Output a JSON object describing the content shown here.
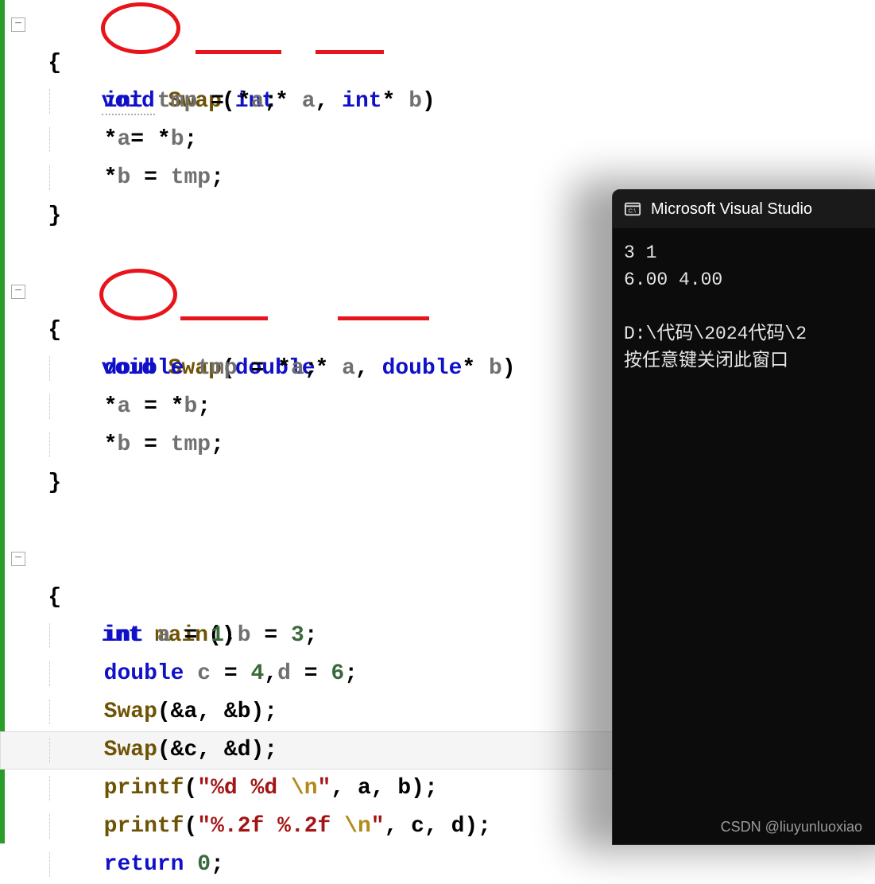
{
  "code": {
    "l1_void": "void",
    "l1_swap": "Swap",
    "l1_int1": "int",
    "l1_a": "a",
    "l1_int2": "int",
    "l1_b": "b",
    "l2_brace": "{",
    "l3_int": "int",
    "l3_tmp": "tmp",
    "l3_eq": " = *",
    "l3_a": "a",
    "l3_semi": ";",
    "l4_lhs": "*",
    "l4_a": "a",
    "l4_mid": "= *",
    "l4_b": "b",
    "l4_semi": ";",
    "l5_lhs": "*",
    "l5_b": "b",
    "l5_mid": " = ",
    "l5_tmp": "tmp",
    "l5_semi": ";",
    "l6_brace": "}",
    "l8_void": "void",
    "l8_swap": "Swap",
    "l8_d1": "double",
    "l8_a": "a",
    "l8_d2": "double",
    "l8_b": "b",
    "l9_brace": "{",
    "l10_dbl": "double",
    "l10_tmp": "tmp",
    "l10_mid": " = *",
    "l10_a": "a",
    "l10_semi": ";",
    "l11_lhs": "*",
    "l11_a": "a",
    "l11_mid": " = *",
    "l11_b": "b",
    "l11_semi": ";",
    "l12_lhs": "*",
    "l12_b": "b",
    "l12_mid": " = ",
    "l12_tmp": "tmp",
    "l12_semi": ";",
    "l13_brace": "}",
    "l15_int": "int",
    "l15_main": "main",
    "l15_paren": "()",
    "l16_brace": "{",
    "l17_int": "int",
    "l17_a": "a",
    "l17_eq1": " = ",
    "l17_1": "1",
    "l17_c": ",",
    "l17_b": "b",
    "l17_eq2": " = ",
    "l17_3": "3",
    "l17_semi": ";",
    "l18_dbl": "double",
    "l18_c": "c",
    "l18_eq1": " = ",
    "l18_4": "4",
    "l18_cm": ",",
    "l18_d": "d",
    "l18_eq2": " = ",
    "l18_6": "6",
    "l18_semi": ";",
    "l19_swap": "Swap",
    "l19_args": "(&a, &b);",
    "l20_swap": "Swap",
    "l20_args": "(&c, &d);",
    "l21_pf": "printf",
    "l21_op": "(",
    "l21_q1": "\"",
    "l21_fmt": "%d %d ",
    "l21_esc": "\\n",
    "l21_q2": "\"",
    "l21_rest": ", a, b);",
    "l22_pf": "printf",
    "l22_op": "(",
    "l22_q1": "\"",
    "l22_fmt": "%.2f %.2f ",
    "l22_esc": "\\n",
    "l22_q2": "\"",
    "l22_rest": ", c, d);",
    "l23_ret": "return",
    "l23_sp": " ",
    "l23_0": "0",
    "l23_semi": ";"
  },
  "console": {
    "title": "Microsoft Visual Studio",
    "out1": "3 1",
    "out2": "6.00 4.00",
    "out_blank": "",
    "out3": "D:\\代码\\2024代码\\2",
    "out4": "按任意键关闭此窗口"
  },
  "watermark": "CSDN @liuyunluoxiao"
}
